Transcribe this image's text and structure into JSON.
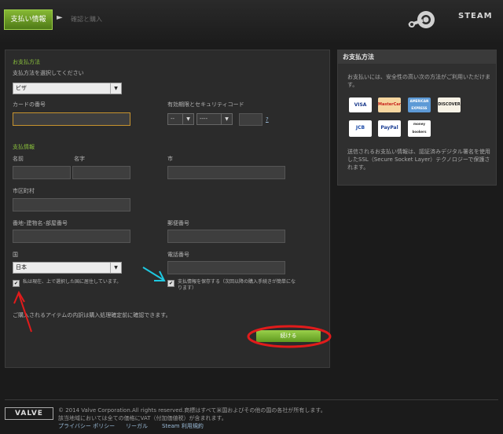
{
  "header": {
    "step1": "支払い情報",
    "step2": "確認と購入",
    "brand": "STEAM"
  },
  "form": {
    "payment_method_section": "お支払方法",
    "payment_method_prompt": "支払方法を選択してください",
    "payment_method_value": "ビザ",
    "card_number_label": "カードの番号",
    "expiry_label": "有効期限とセキュリティコード",
    "expiry_month": "--",
    "expiry_year": "----",
    "cvv_help": "?",
    "billing_section": "支払情報",
    "first_name_label": "名前",
    "last_name_label": "名字",
    "city_label": "市",
    "ward_label": "市区町村",
    "address_label": "番地･建物名･部屋番号",
    "postal_label": "郵便番号",
    "country_label": "国",
    "country_value": "日本",
    "phone_label": "電話番号",
    "residence_checkbox": "私は現在、上で選択した国に居住しています。",
    "save_payment_checkbox": "支払情報を保存する（次回以降の購入手続きが簡単になります）",
    "confirm_note": "ご購入されるアイテムの内訳は購入処理確定前に確認できます。",
    "continue_button": "続ける"
  },
  "side": {
    "title": "お支払方法",
    "intro": "お支払いには、安全性の高い次の方法がご利用いただけます。",
    "secure_note": "送信されるお支払い情報は、認証済みデジタル署名を使用したSSL（Secure Socket Layer）テクノロジーで保護されます。",
    "cards": [
      "VISA",
      "MasterCard",
      "AMERICAN EXPRESS",
      "DISCOVER",
      "JCB",
      "PayPal",
      "money bookers"
    ]
  },
  "footer": {
    "logo": "VALVE",
    "copyright": "© 2014 Valve Corporation.All rights reserved.商標はすべて米国およびその他の国の各社が所有します。",
    "tax_note": "該当地域においては全ての価格にVAT（付加価値税）が含まれます。",
    "privacy": "プライバシー ポリシー",
    "legal": "リーガル",
    "terms": "Steam 利用規約"
  },
  "colors": {
    "accent_green": "#8ac03c",
    "link_blue": "#9bbcd9",
    "annotation_red": "#e11b1b",
    "annotation_cyan": "#1ec8e0"
  }
}
